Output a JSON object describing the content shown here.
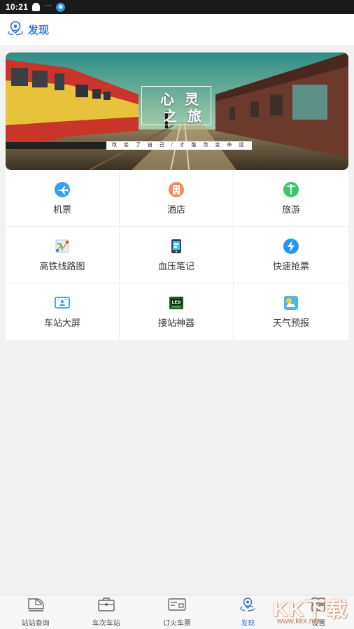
{
  "status_bar": {
    "time": "10:21",
    "dots": "···",
    "bt_glyph": "✱"
  },
  "header": {
    "title": "发现"
  },
  "banner": {
    "title_line1": "心 灵",
    "title_line2": "之 旅",
    "subtitle": "改 变 了 自 己 / 才 能 改 变 命 运"
  },
  "grid": [
    {
      "label": "机票",
      "icon": "airplane-icon"
    },
    {
      "label": "酒店",
      "icon": "hotel-icon"
    },
    {
      "label": "旅游",
      "icon": "palm-tree-icon"
    },
    {
      "label": "高铁线路图",
      "icon": "route-map-icon"
    },
    {
      "label": "血压笔记",
      "icon": "blood-pressure-notes-icon"
    },
    {
      "label": "快速抢票",
      "icon": "lightning-icon"
    },
    {
      "label": "车站大屏",
      "icon": "station-screen-icon"
    },
    {
      "label": "接站神器",
      "icon": "led-sign-icon"
    },
    {
      "label": "天气预报",
      "icon": "weather-icon"
    }
  ],
  "bottom_nav": [
    {
      "label": "站站查询",
      "icon": "train-icon",
      "active": false
    },
    {
      "label": "车次车站",
      "icon": "briefcase-icon",
      "active": false
    },
    {
      "label": "订火车票",
      "icon": "ticket-icon",
      "active": false
    },
    {
      "label": "发现",
      "icon": "discover-icon",
      "active": true
    },
    {
      "label": "设置",
      "icon": "settings-grid-icon",
      "active": false
    }
  ],
  "watermark": {
    "text": "KK下载",
    "url": "www.kkx.net"
  },
  "colors": {
    "accent": "#3a7bd5",
    "status_bar": "#1a1a1a",
    "page_bg": "#f2f2f2"
  }
}
